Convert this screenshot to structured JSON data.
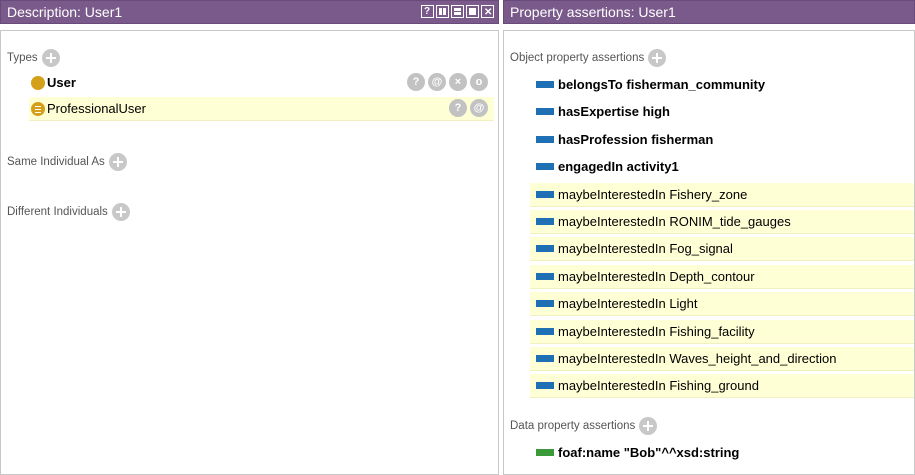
{
  "left_panel": {
    "title": "Description: User1",
    "types_label": "Types",
    "types": [
      {
        "label": "User",
        "bold": true,
        "actions": [
          "?",
          "@",
          "×",
          "o"
        ]
      },
      {
        "label": "ProfessionalUser",
        "bold": false,
        "actions": [
          "?",
          "@"
        ]
      }
    ],
    "same_label": "Same Individual As",
    "different_label": "Different Individuals"
  },
  "right_panel": {
    "title": "Property assertions: User1",
    "object_label": "Object property assertions",
    "object_assertions": [
      {
        "property": "belongsTo",
        "value": "fisherman_community",
        "bold": true
      },
      {
        "property": "hasExpertise",
        "value": "high",
        "bold": true
      },
      {
        "property": "hasProfession",
        "value": "fisherman",
        "bold": true
      },
      {
        "property": "engagedIn",
        "value": "activity1",
        "bold": true
      },
      {
        "property": "maybeInterestedIn",
        "value": "Fishery_zone",
        "bold": false
      },
      {
        "property": "maybeInterestedIn",
        "value": "RONIM_tide_gauges",
        "bold": false
      },
      {
        "property": "maybeInterestedIn",
        "value": "Fog_signal",
        "bold": false
      },
      {
        "property": "maybeInterestedIn",
        "value": "Depth_contour",
        "bold": false
      },
      {
        "property": "maybeInterestedIn",
        "value": "Light",
        "bold": false
      },
      {
        "property": "maybeInterestedIn",
        "value": "Fishing_facility",
        "bold": false
      },
      {
        "property": "maybeInterestedIn",
        "value": "Waves_height_and_direction",
        "bold": false
      },
      {
        "property": "maybeInterestedIn",
        "value": "Fishing_ground",
        "bold": false
      }
    ],
    "data_label": "Data property assertions",
    "data_assertions": [
      {
        "property": "foaf:name",
        "value": "\"Bob\"^^xsd:string",
        "bold": true
      }
    ]
  },
  "colors": {
    "titlebar": "#7a5a8a",
    "object_property": "#1f6fb5",
    "data_property": "#3a9a3a",
    "class_icon": "#d4a017",
    "inferred_bg": "#ffffd6"
  },
  "icons": {
    "titlebar_controls": [
      "help-icon",
      "split-icon",
      "minimize-icon",
      "maximize-icon",
      "close-icon"
    ]
  }
}
